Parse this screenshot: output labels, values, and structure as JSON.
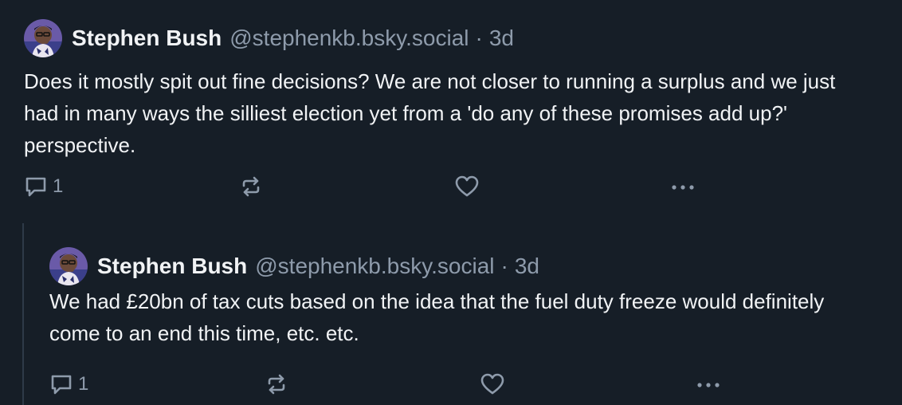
{
  "theme": {
    "background": "#161e27",
    "text": "#f1f3f5",
    "muted": "#8e9bab",
    "thread_line": "#2e3a48"
  },
  "posts": [
    {
      "author": {
        "display_name": "Stephen Bush",
        "handle": "@stephenkb.bsky.social",
        "avatar_icon": "avatar-photo"
      },
      "separator": "·",
      "timestamp": "3d",
      "text": "Does it mostly spit out fine decisions? We are not closer to running a surplus and we just had in many ways the silliest election yet from a 'do any of these promises add up?' perspective.",
      "actions": {
        "reply_count": "1",
        "reply_icon": "speech-bubble-icon",
        "repost_icon": "repost-icon",
        "like_icon": "heart-icon",
        "more_icon": "more-dots-icon"
      }
    },
    {
      "author": {
        "display_name": "Stephen Bush",
        "handle": "@stephenkb.bsky.social",
        "avatar_icon": "avatar-photo"
      },
      "separator": "·",
      "timestamp": "3d",
      "text": "We had £20bn of tax cuts based on the idea that the fuel duty freeze would definitely come to an end this time, etc. etc.",
      "actions": {
        "reply_count": "1",
        "reply_icon": "speech-bubble-icon",
        "repost_icon": "repost-icon",
        "like_icon": "heart-icon",
        "more_icon": "more-dots-icon"
      }
    }
  ]
}
